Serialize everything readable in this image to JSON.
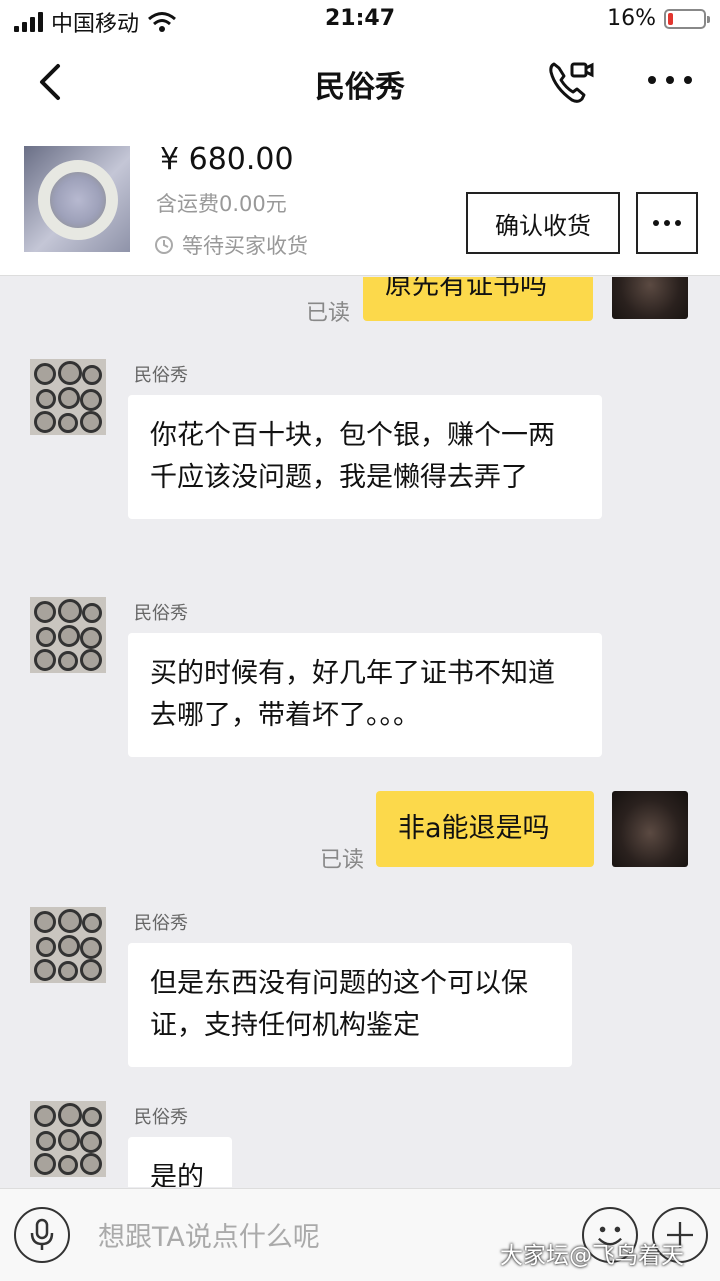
{
  "status_bar": {
    "carrier": "中国移动",
    "time": "21:47",
    "battery": "16%",
    "battery_level": 0.16
  },
  "nav": {
    "title": "民俗秀"
  },
  "product": {
    "price": "¥ 680.00",
    "shipping": "含运费0.00元",
    "status": "等待买家收货",
    "confirm_button": "确认收货"
  },
  "messages": [
    {
      "from": "me",
      "text": "原先有证书吗",
      "read": "已读"
    },
    {
      "from": "seller",
      "sender": "民俗秀",
      "text": "你花个百十块，包个银，赚个一两千应该没问题，我是懒得去弄了"
    },
    {
      "from": "seller",
      "sender": "民俗秀",
      "text": "买的时候有，好几年了证书不知道去哪了，带着坏了。。。"
    },
    {
      "from": "me",
      "text": "非a能退是吗",
      "read": "已读"
    },
    {
      "from": "seller",
      "sender": "民俗秀",
      "text": "但是东西没有问题的这个可以保证，支持任何机构鉴定"
    },
    {
      "from": "seller",
      "sender": "民俗秀",
      "text": "是的"
    }
  ],
  "input": {
    "placeholder": "想跟TA说点什么呢"
  },
  "watermark": "大家坛@飞鸟着天"
}
